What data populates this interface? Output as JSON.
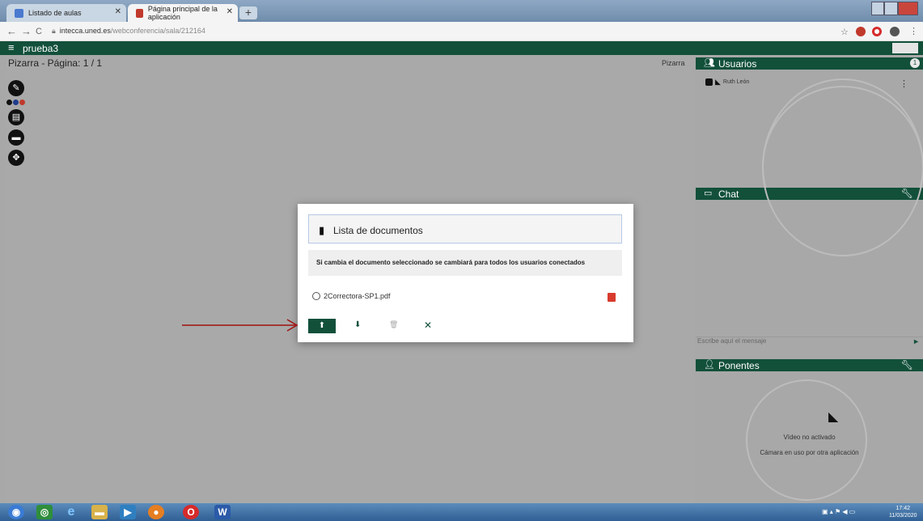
{
  "browser": {
    "tabs": [
      {
        "label": "Listado de aulas",
        "active": false
      },
      {
        "label": "Página principal de la aplicación",
        "active": true
      }
    ],
    "new_tab_label": "+",
    "address": {
      "host": "intecca.uned.es",
      "path": "/webconferencia/sala/212164"
    },
    "nav": {
      "back": "←",
      "forward": "→",
      "reload": "C"
    }
  },
  "app": {
    "room_title": "prueba3"
  },
  "board": {
    "title": "Pizarra - Página: 1 / 1",
    "tag": "Pizarra",
    "swatch_colors": [
      "#111111",
      "#1e3c8c",
      "#c0392b"
    ]
  },
  "users_panel": {
    "title": "Usuarios",
    "count": "1",
    "users": [
      {
        "name": "Ruth León"
      }
    ]
  },
  "chat_panel": {
    "title": "Chat",
    "input_placeholder": "Escribe aquí el mensaje",
    "send": "►"
  },
  "speakers_panel": {
    "title": "Ponentes",
    "video_status": "Vídeo no activado",
    "camera_status": "Cámara en uso por otra aplicación"
  },
  "modal": {
    "title": "Lista de documentos",
    "warning": "Si cambia el documento seleccionado se cambiará para todos los usuarios conectados",
    "documents": [
      {
        "name": "2Correctora-SP1.pdf"
      }
    ],
    "buttons": {
      "upload": "⬆",
      "download": "⬇",
      "delete": "🗑",
      "close": "✕"
    }
  },
  "taskbar": {
    "time": "17:42",
    "date": "11/03/2020"
  },
  "colors": {
    "brand_green": "#12503a",
    "annotation_red": "#a01010",
    "pdf_red": "#d83b2d"
  }
}
